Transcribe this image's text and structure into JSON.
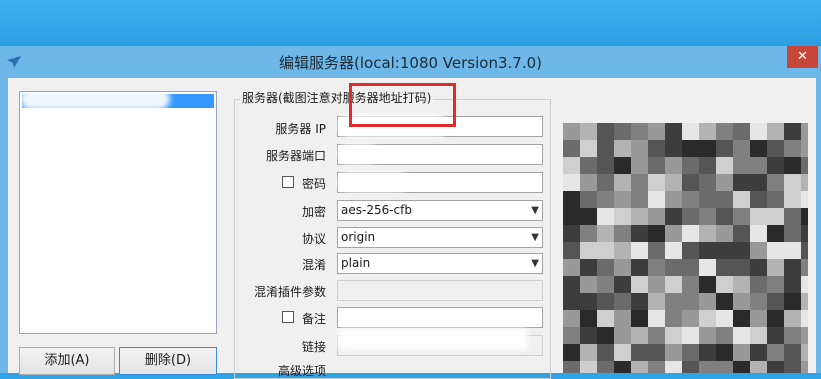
{
  "window": {
    "title": "编辑服务器(local:1080 Version3.7.0)",
    "close_glyph": "✕"
  },
  "server_list": {
    "items": [
      ""
    ]
  },
  "buttons": {
    "add_label": "添加(A)",
    "delete_label": "删除(D)"
  },
  "group": {
    "title": "服务器(截图注意对服务器地址打码)",
    "fields": {
      "server_ip_label": "服务器 IP",
      "server_ip_value": "",
      "server_port_label": "服务器端口",
      "server_port_value": "",
      "password_label": "密码",
      "password_value": "",
      "encryption_label": "加密",
      "encryption_value": "aes-256-cfb",
      "protocol_label": "协议",
      "protocol_value": "origin",
      "obfs_label": "混淆",
      "obfs_value": "plain",
      "obfs_param_label": "混淆插件参数",
      "obfs_param_value": "",
      "remarks_label": "备注",
      "remarks_value": "",
      "link_label": "链接",
      "advanced_label": "高级选项"
    }
  },
  "colors": {
    "title_bar": "#6db8e9",
    "close": "#c7463a",
    "highlight": "#e12a2a",
    "selection": "#3399ff"
  },
  "icons": {
    "app": "paper-plane-icon",
    "dropdown": "chevron-down-icon",
    "close": "close-icon"
  }
}
